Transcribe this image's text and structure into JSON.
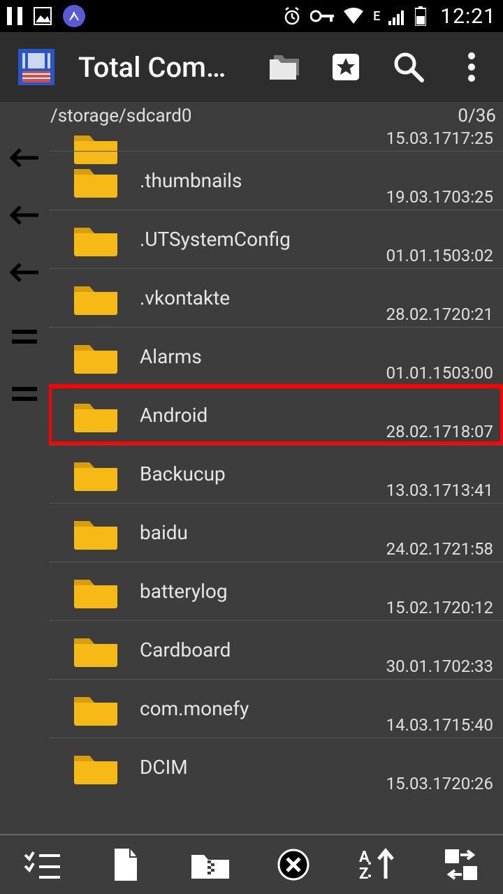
{
  "status": {
    "time": "12:21",
    "network_type": "E"
  },
  "app": {
    "title": "Total Com…"
  },
  "panel": {
    "path": "/storage/sdcard0",
    "counter": "0/36"
  },
  "highlight_index": 5,
  "files": [
    {
      "name": "",
      "type": "<dir>",
      "date": "15.03.17",
      "time": "17:25",
      "partial": true
    },
    {
      "name": ".thumbnails",
      "type": "<dir>",
      "date": "19.03.17",
      "time": "03:25"
    },
    {
      "name": ".UTSystemConfig",
      "type": "<dir>",
      "date": "01.01.15",
      "time": "03:02"
    },
    {
      "name": ".vkontakte",
      "type": "<dir>",
      "date": "28.02.17",
      "time": "20:21"
    },
    {
      "name": "Alarms",
      "type": "<dir>",
      "date": "01.01.15",
      "time": "03:00"
    },
    {
      "name": "Android",
      "type": "<dir>",
      "date": "28.02.17",
      "time": "18:07"
    },
    {
      "name": "Backucup",
      "type": "<dir>",
      "date": "13.03.17",
      "time": "13:41"
    },
    {
      "name": "baidu",
      "type": "<dir>",
      "date": "24.02.17",
      "time": "21:58"
    },
    {
      "name": "batterylog",
      "type": "<dir>",
      "date": "15.02.17",
      "time": "20:12"
    },
    {
      "name": "Cardboard",
      "type": "<dir>",
      "date": "30.01.17",
      "time": "02:33"
    },
    {
      "name": "com.monefy",
      "type": "<dir>",
      "date": "14.03.17",
      "time": "15:40"
    },
    {
      "name": "DCIM",
      "type": "<dir>",
      "date": "15.03.17",
      "time": "20:26"
    }
  ]
}
